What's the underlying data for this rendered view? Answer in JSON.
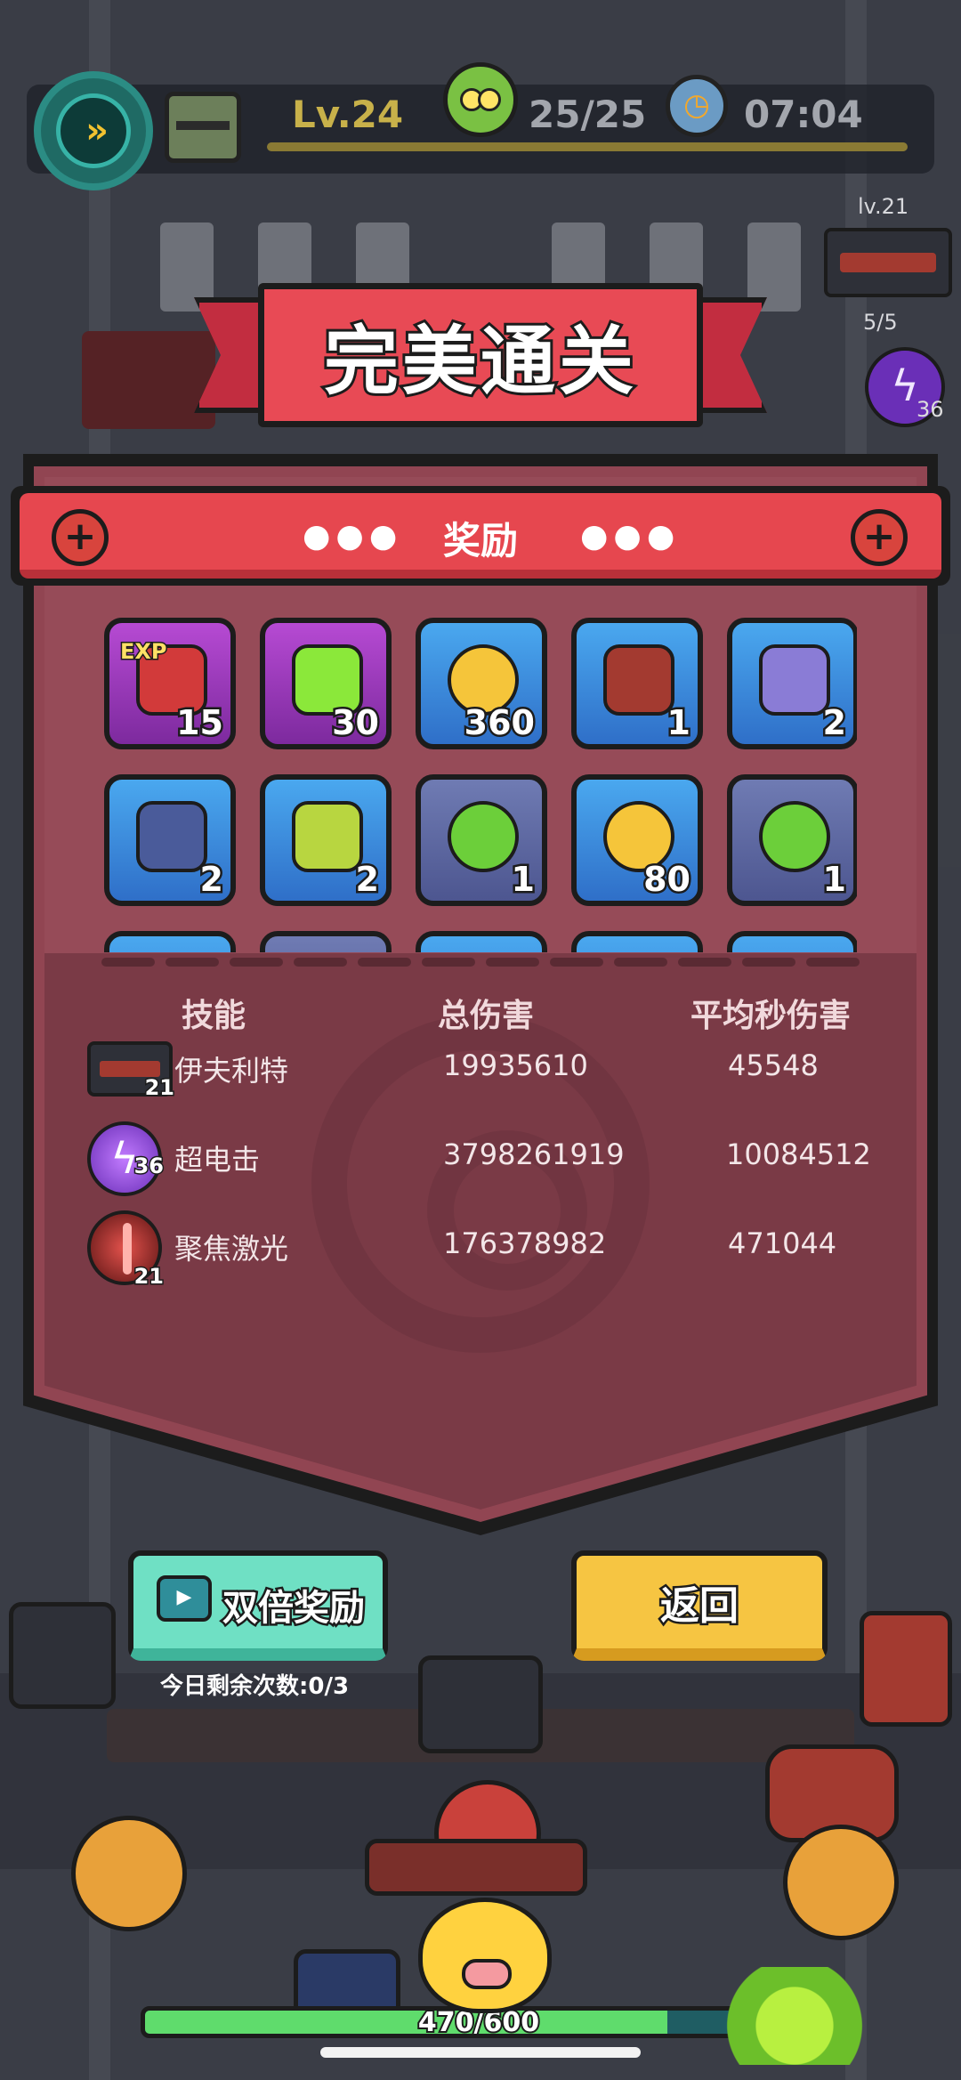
{
  "hud": {
    "level": "Lv.24",
    "wave": "25/25",
    "timer": "07:04",
    "side_gun_level": "lv.21",
    "side_count": "5/5",
    "side_skill_level": "36"
  },
  "title": "完美通关",
  "rewards_header": "奖励",
  "rewards": [
    {
      "icon": "exp-bottle-icon",
      "count": "15",
      "style": "purple",
      "color": "#d23a3a",
      "exp_label": "EXP"
    },
    {
      "icon": "green-gem-icon",
      "count": "30",
      "style": "purple",
      "color": "#8be83a"
    },
    {
      "icon": "gold-coin-icon",
      "count": "360",
      "style": "blue",
      "color": "#f5c53a"
    },
    {
      "icon": "barrel-cannon-icon",
      "count": "1",
      "style": "blue",
      "color": "#a33a30"
    },
    {
      "icon": "blueprint-scroll-icon",
      "count": "2",
      "style": "blue",
      "color": "#8a7cd6"
    },
    {
      "icon": "dark-ore-icon",
      "count": "2",
      "style": "blue",
      "color": "#4a5b9a"
    },
    {
      "icon": "green-ore-icon",
      "count": "2",
      "style": "blue",
      "color": "#b8d640"
    },
    {
      "icon": "green-slime-icon",
      "count": "1",
      "style": "slate",
      "color": "#6ccf3a"
    },
    {
      "icon": "gold-coin-icon",
      "count": "80",
      "style": "blue",
      "color": "#f5c53a"
    },
    {
      "icon": "green-slime-icon",
      "count": "1",
      "style": "slate",
      "color": "#6ccf3a"
    }
  ],
  "table": {
    "headers": [
      "技能",
      "总伤害",
      "平均秒伤害"
    ],
    "rows": [
      {
        "icon": "gun-turret-icon",
        "level": "21",
        "skill": "伊夫利特",
        "total": "19935610",
        "dps": "45548"
      },
      {
        "icon": "lightning-icon",
        "level": "36",
        "skill": "超电击",
        "total": "3798261919",
        "dps": "10084512"
      },
      {
        "icon": "laser-icon",
        "level": "21",
        "skill": "聚焦激光",
        "total": "176378982",
        "dps": "471044"
      }
    ]
  },
  "buttons": {
    "double_reward": "双倍奖励",
    "remaining": "今日剩余次数:0/3",
    "back": "返回"
  },
  "hp": {
    "text": "470/600",
    "fraction": 0.7833
  }
}
